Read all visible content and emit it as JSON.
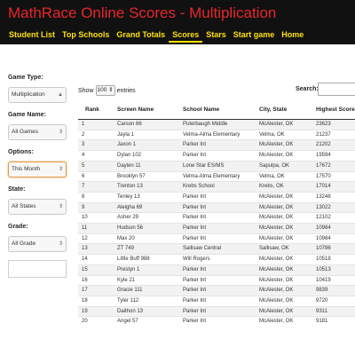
{
  "header": {
    "title": "MathRace Online Scores - Multiplication",
    "nav": [
      {
        "label": "Student List",
        "active": false
      },
      {
        "label": "Top Schools",
        "active": false
      },
      {
        "label": "Grand Totals",
        "active": false
      },
      {
        "label": "Scores",
        "active": true
      },
      {
        "label": "Stars",
        "active": false
      },
      {
        "label": "Start game",
        "active": false
      },
      {
        "label": "Home",
        "active": false
      }
    ]
  },
  "filters": {
    "game_type": {
      "label": "Game Type:",
      "value": "Multiplication"
    },
    "game_name": {
      "label": "Game Name:",
      "value": "All Games"
    },
    "options": {
      "label": "Options:",
      "value": "This Month"
    },
    "state": {
      "label": "State:",
      "value": "All States"
    },
    "grade": {
      "label": "Grade:",
      "value": "All Grade"
    }
  },
  "controls": {
    "show_label": "Show",
    "entries_value": "100",
    "entries_label": "entries",
    "search_label": "Search:"
  },
  "table": {
    "columns": [
      "Rank",
      "Screen Name",
      "School Name",
      "City, State",
      "Highest Score"
    ],
    "rows": [
      [
        "1",
        "Carson 66",
        "Puterbaugh Middle",
        "McAlester, OK",
        "23623"
      ],
      [
        "2",
        "Jayla 1",
        "Velma-Alma Elementary",
        "Velma, OK",
        "21237"
      ],
      [
        "3",
        "Jaxon 1",
        "Parker Int",
        "McAlester, OK",
        "21202"
      ],
      [
        "4",
        "Dylan 102",
        "Parker Int",
        "McAlester, OK",
        "19594"
      ],
      [
        "5",
        "Daylen 11",
        "Lone Star ES/MS",
        "Sapulpa, OK",
        "17672"
      ],
      [
        "6",
        "Brooklyn 57",
        "Velma-Alma Elementary",
        "Velma, OK",
        "17570"
      ],
      [
        "7",
        "Trenton 13",
        "Krebs School",
        "Krebs, OK",
        "17014"
      ],
      [
        "8",
        "Tenley 13",
        "Parker Int",
        "McAlester, OK",
        "13248"
      ],
      [
        "9",
        "Aleigha 69",
        "Parker Int",
        "McAlester, OK",
        "13022"
      ],
      [
        "10",
        "Asher 29",
        "Parker Int",
        "McAlester, OK",
        "12102"
      ],
      [
        "11",
        "Hudson 56",
        "Parker Int",
        "McAlester, OK",
        "10984"
      ],
      [
        "12",
        "Max 20",
        "Parker Int",
        "McAlester, OK",
        "10984"
      ],
      [
        "13",
        "ZT 749",
        "Sallisaw Central",
        "Sallisaw, OK",
        "10786"
      ],
      [
        "14",
        "Little Buff 988",
        "Will Rogers",
        "McAlester, OK",
        "10518"
      ],
      [
        "15",
        "Prestyn 1",
        "Parker Int",
        "McAlester, OK",
        "10513"
      ],
      [
        "16",
        "Kyle 21",
        "Parker Int",
        "McAlester, OK",
        "10419"
      ],
      [
        "17",
        "Gracie 111",
        "Parker Int",
        "McAlester, OK",
        "9839"
      ],
      [
        "18",
        "Tyler 112",
        "Parker Int",
        "McAlester, OK",
        "9720"
      ],
      [
        "19",
        "Daithon 13",
        "Parker Int",
        "McAlester, OK",
        "9311"
      ],
      [
        "20",
        "Angel 57",
        "Parker Int",
        "McAlester, OK",
        "9181"
      ]
    ]
  }
}
